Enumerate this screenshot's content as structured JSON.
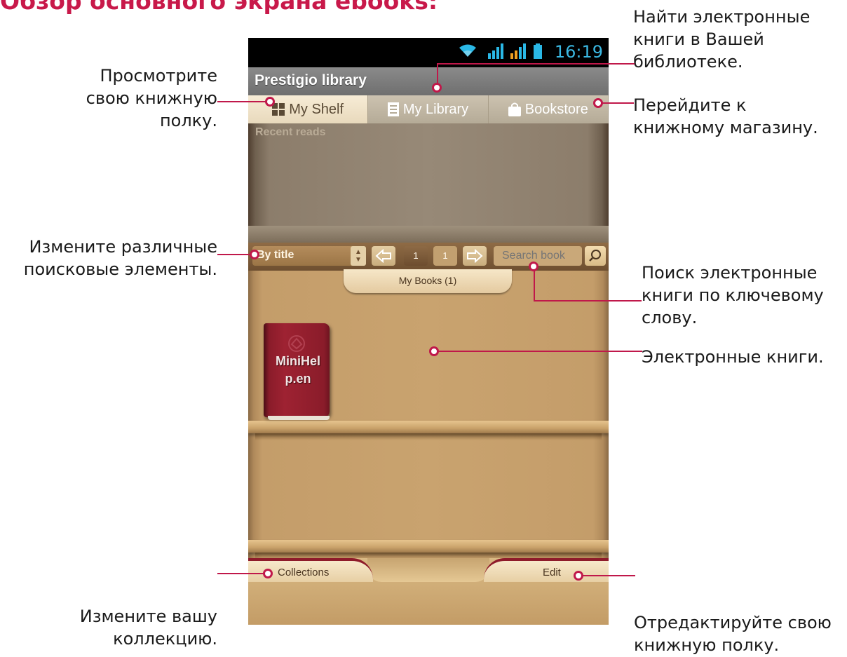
{
  "document": {
    "heading": "Обзор основного экрана ebooks:"
  },
  "callouts": {
    "shelf": [
      "Просмотрите",
      "свою книжную",
      "полку."
    ],
    "library": [
      "Найти электронные",
      "книги в Вашей",
      "библиотеке."
    ],
    "bookstore": [
      "Перейдите к",
      "книжному магазину."
    ],
    "filters": [
      "Измените различные",
      "поисковые элементы."
    ],
    "search": [
      "Поиск электронные",
      "книги по ключевому",
      "слову."
    ],
    "ebooks": [
      "Электронные книги."
    ],
    "collection": [
      "Измените вашу",
      "коллекцию."
    ],
    "edit": [
      "Отредактируйте свою",
      "книжную полку."
    ]
  },
  "status_bar": {
    "time": "16:19",
    "icons": [
      "wifi-icon",
      "signal-icon",
      "signal-icon",
      "battery-icon"
    ]
  },
  "app": {
    "title": "Prestigio library",
    "tabs": [
      {
        "label": "My Shelf",
        "icon": "grid-icon",
        "active": true
      },
      {
        "label": "My Library",
        "icon": "list-icon",
        "active": false
      },
      {
        "label": "Bookstore",
        "icon": "shopping-bag-icon",
        "active": false
      }
    ],
    "recent_reads_label": "Recent reads",
    "filter_bar": {
      "sort_value": "By title",
      "current_page": "1",
      "total_pages": "1",
      "search_placeholder": "Search book"
    },
    "collection_label": "My Books (1)",
    "books": [
      {
        "title": "MiniHelp.en",
        "title_lines": [
          "MiniHel",
          "p.en"
        ],
        "color": "#9e2232"
      }
    ],
    "bottom": {
      "collections_label": "Collections",
      "edit_label": "Edit"
    }
  },
  "colors": {
    "accent": "#c0184a",
    "heading": "#c8194a",
    "status_icons": "#2ab8e6"
  }
}
